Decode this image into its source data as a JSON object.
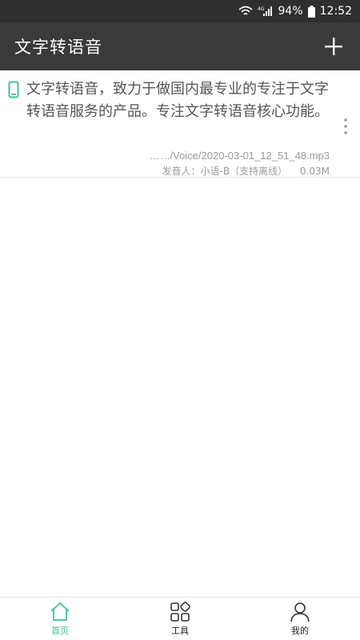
{
  "status_bar": {
    "battery": "94%",
    "time": "12:52",
    "network": "4G"
  },
  "app_bar": {
    "title": "文字转语音",
    "add_icon": "plus-icon"
  },
  "items": [
    {
      "text": "文字转语音，致力于做国内最专业的专注于文字转语音服务的产品。专注文字转语音核心功能。",
      "path": "... .../Voice/2020-03-01_12_51_48.mp3",
      "speaker": "发音人：小语-B（支持离线）",
      "size": "0.03M"
    }
  ],
  "bottom_nav": [
    {
      "label": "首页",
      "icon": "home-icon",
      "active": true
    },
    {
      "label": "工具",
      "icon": "grid-icon",
      "active": false
    },
    {
      "label": "我的",
      "icon": "user-icon",
      "active": false
    }
  ],
  "colors": {
    "accent": "#3fbfa0",
    "app_bar": "#3a3a3a",
    "status_bar": "#2f2f2f"
  }
}
